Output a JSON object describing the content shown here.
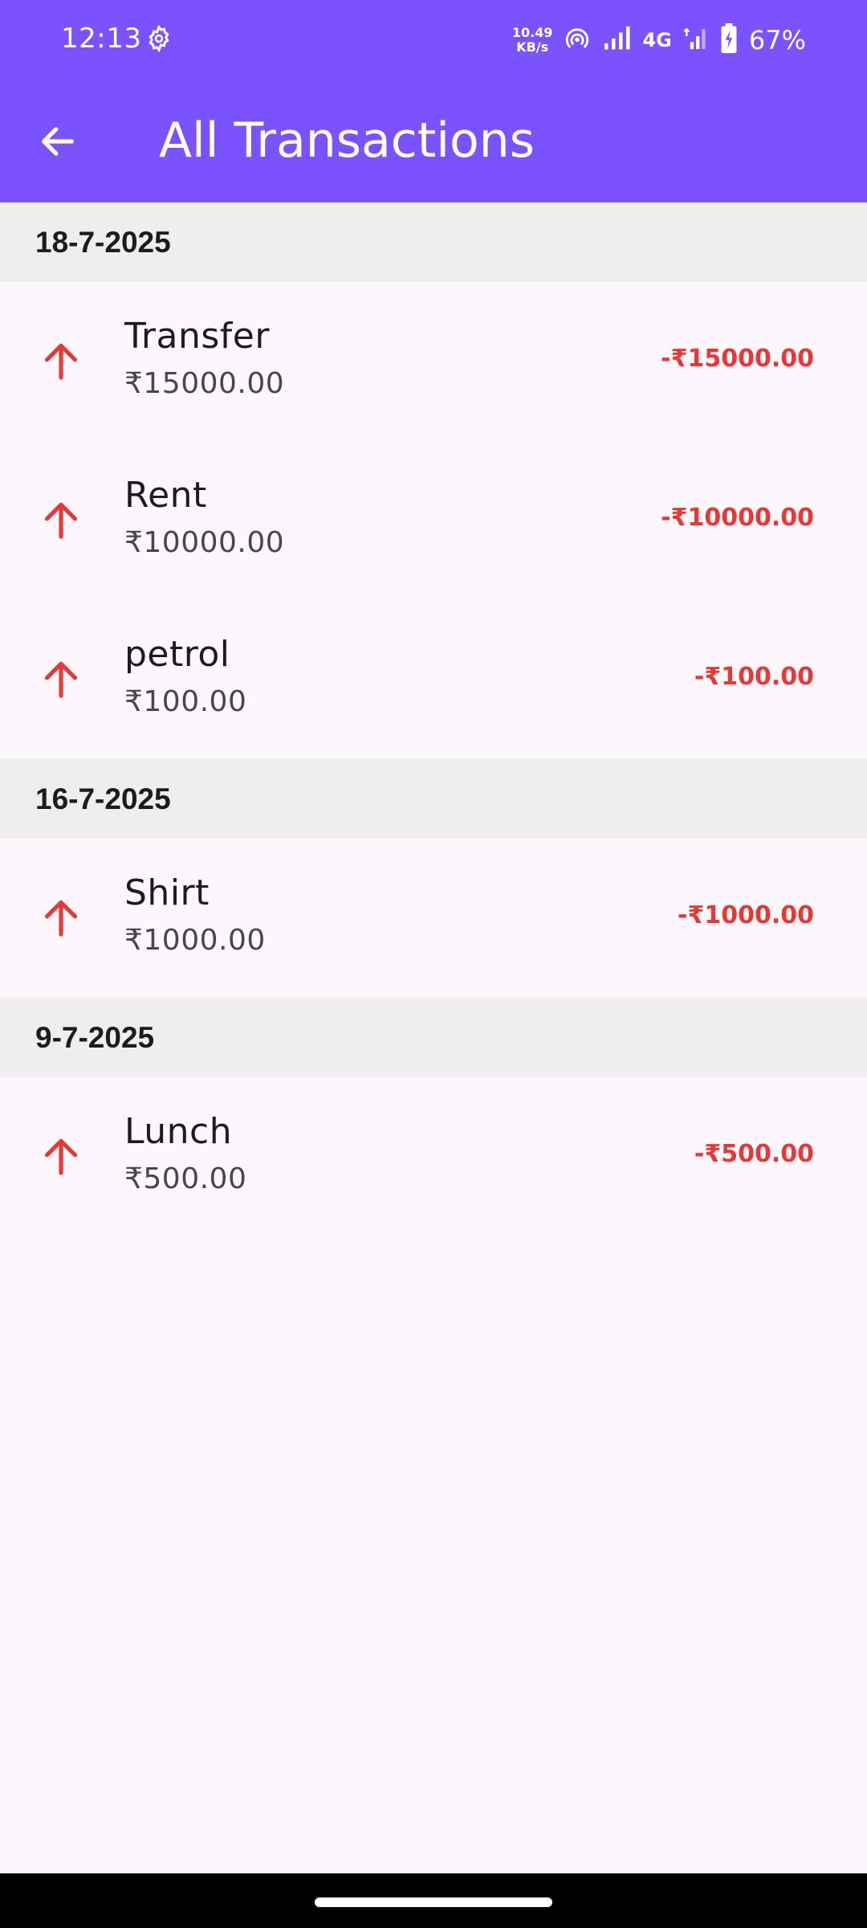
{
  "status_bar": {
    "time": "12:13",
    "net_speed_value": "10.49",
    "net_speed_unit": "KB/s",
    "network_type": "4G",
    "battery": "67%",
    "icons": [
      "settings-gear-icon",
      "hotspot-icon",
      "signal-icon",
      "signal-icon",
      "battery-charging-icon"
    ]
  },
  "app_bar": {
    "title": "All Transactions",
    "back_icon": "arrow-back-icon",
    "color": "#7c52ff"
  },
  "groups": [
    {
      "date": "18-7-2025",
      "transactions": [
        {
          "title": "Transfer",
          "subtitle": "₹15000.00",
          "amount": "-₹15000.00",
          "icon": "arrow-up-icon"
        },
        {
          "title": "Rent",
          "subtitle": "₹10000.00",
          "amount": "-₹10000.00",
          "icon": "arrow-up-icon"
        },
        {
          "title": "petrol",
          "subtitle": "₹100.00",
          "amount": "-₹100.00",
          "icon": "arrow-up-icon"
        }
      ]
    },
    {
      "date": "16-7-2025",
      "transactions": [
        {
          "title": "Shirt",
          "subtitle": "₹1000.00",
          "amount": "-₹1000.00",
          "icon": "arrow-up-icon"
        }
      ]
    },
    {
      "date": "9-7-2025",
      "transactions": [
        {
          "title": "Lunch",
          "subtitle": "₹500.00",
          "amount": "-₹500.00",
          "icon": "arrow-up-icon"
        }
      ]
    }
  ],
  "colors": {
    "expense": "#e53935",
    "background": "#fdf6fd",
    "date_header_bg": "#eeeeee"
  }
}
